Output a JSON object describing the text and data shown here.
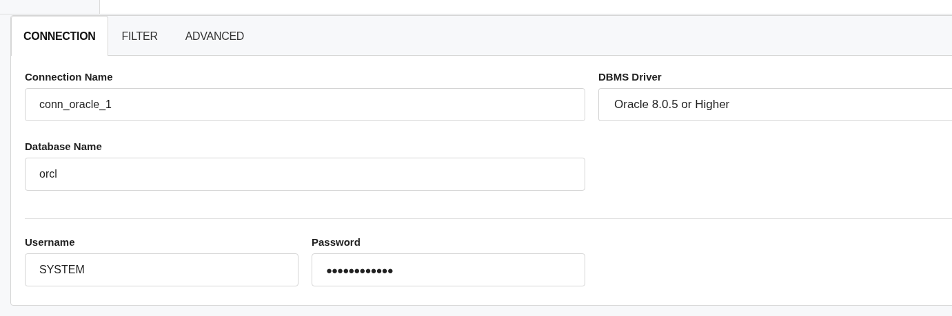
{
  "tabs": [
    {
      "label": "CONNECTION",
      "selected": true
    },
    {
      "label": "FILTER",
      "selected": false
    },
    {
      "label": "ADVANCED",
      "selected": false
    }
  ],
  "sections": [
    {
      "fields": [
        {
          "label": "Connection Name",
          "value": "conn_oracle_1",
          "kind": "text"
        },
        {
          "label": "DBMS Driver",
          "value": "Oracle 8.0.5 or Higher",
          "kind": "select"
        },
        {
          "label": "Database Name",
          "value": "orcl",
          "kind": "text"
        }
      ]
    },
    {
      "fields": [
        {
          "label": "Username",
          "value": "SYSTEM",
          "kind": "text"
        },
        {
          "label": "Password",
          "value": "●●●●●●●●●●●●",
          "kind": "password"
        }
      ]
    }
  ]
}
